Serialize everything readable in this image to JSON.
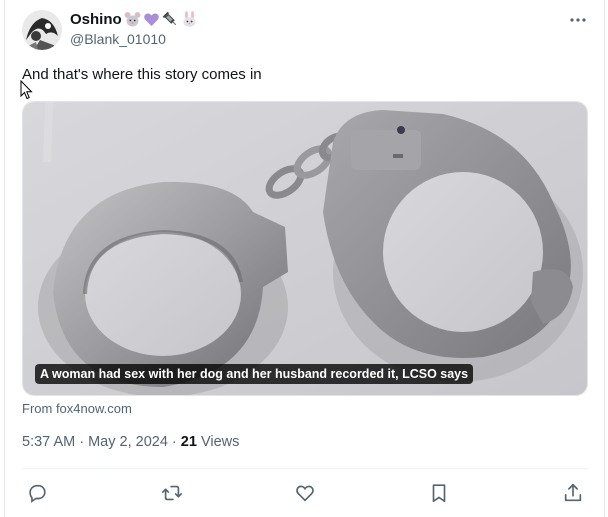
{
  "author": {
    "display_name": "Oshino",
    "handle": "@Blank_01010",
    "emoji_icons": [
      "mouse-face-icon",
      "purple-heart-icon",
      "syringe-icon",
      "rabbit-face-icon"
    ]
  },
  "more_icon": "more-horizontal-icon",
  "tweet": {
    "text": "And that's where this story comes in"
  },
  "media": {
    "caption": "A woman had sex with her dog and her husband recorded it, LCSO says",
    "source": "From fox4now.com"
  },
  "meta": {
    "time": "5:37 AM",
    "separator1": " · ",
    "date": "May 2, 2024",
    "separator2": " · ",
    "views_count": "21",
    "views_label": " Views"
  },
  "actions": [
    {
      "name": "reply-icon"
    },
    {
      "name": "retweet-icon"
    },
    {
      "name": "like-icon"
    },
    {
      "name": "bookmark-icon"
    },
    {
      "name": "share-icon"
    }
  ],
  "colors": {
    "text_primary": "#0f1419",
    "text_secondary": "#536471",
    "divider": "#eff3f4"
  }
}
